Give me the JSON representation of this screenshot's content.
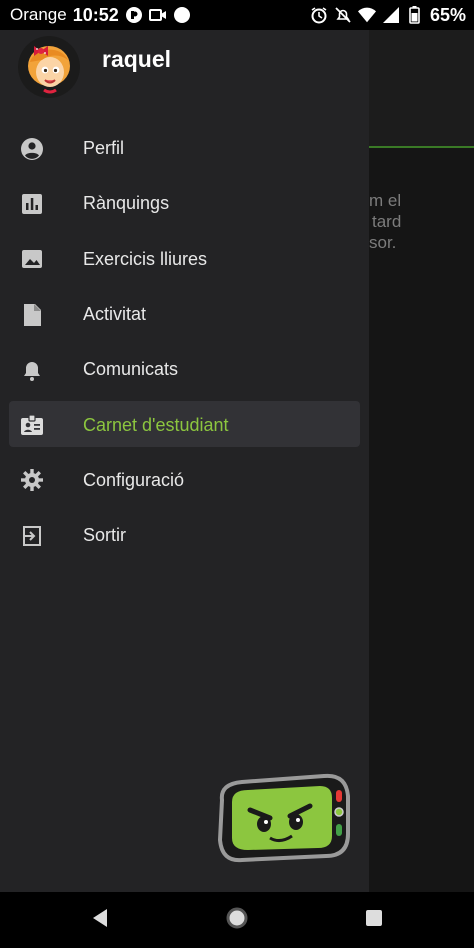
{
  "status_bar": {
    "carrier": "Orange",
    "time": "10:52",
    "battery_percent": "65%",
    "icons_left": [
      "whatsapp-icon",
      "video-icon",
      "circle-icon"
    ],
    "icons_right": [
      "alarm-icon",
      "mute-icon",
      "wifi-icon",
      "signal-icon",
      "battery-icon"
    ]
  },
  "background_app": {
    "message_fragments": [
      "m el",
      "tard",
      "sor."
    ],
    "accent_color": "#3a7a26"
  },
  "drawer": {
    "username": "raquel",
    "menu": [
      {
        "label": "Perfil",
        "icon": "account-circle-icon"
      },
      {
        "label": "Rànquings",
        "icon": "bar-chart-icon"
      },
      {
        "label": "Exercicis lliures",
        "icon": "image-icon"
      },
      {
        "label": "Activitat",
        "icon": "document-icon"
      },
      {
        "label": "Comunicats",
        "icon": "bell-icon"
      },
      {
        "label": "Carnet d'estudiant",
        "icon": "id-badge-icon",
        "active": true
      },
      {
        "label": "Configuració",
        "icon": "gear-icon"
      },
      {
        "label": "Sortir",
        "icon": "exit-icon"
      }
    ],
    "active_color": "#8cc63f"
  },
  "nav_bar": {
    "buttons": [
      "back-icon",
      "home-icon",
      "recents-icon"
    ]
  }
}
